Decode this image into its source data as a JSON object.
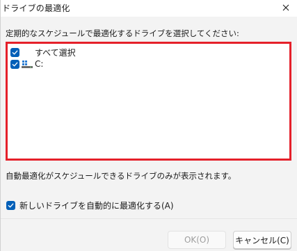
{
  "window": {
    "title": "ドライブの最適化"
  },
  "instruction": "定期的なスケジュールで最適化するドライブを選択してください:",
  "drive_list": {
    "items": [
      {
        "label": "すべて選択",
        "checked": true
      },
      {
        "label": "C:",
        "checked": true,
        "icon": "windows-drive-icon"
      }
    ]
  },
  "note": "自動最適化がスケジュールできるドライブのみが表示されます。",
  "auto_optimize": {
    "label": "新しいドライブを自動的に最適化する(A)",
    "checked": true
  },
  "buttons": {
    "ok": "OK(O)",
    "cancel": "キャンセル(C)"
  },
  "colors": {
    "accent": "#005fb8",
    "highlight_border": "#e5202a",
    "dialog_bg": "#f3f3f3"
  }
}
